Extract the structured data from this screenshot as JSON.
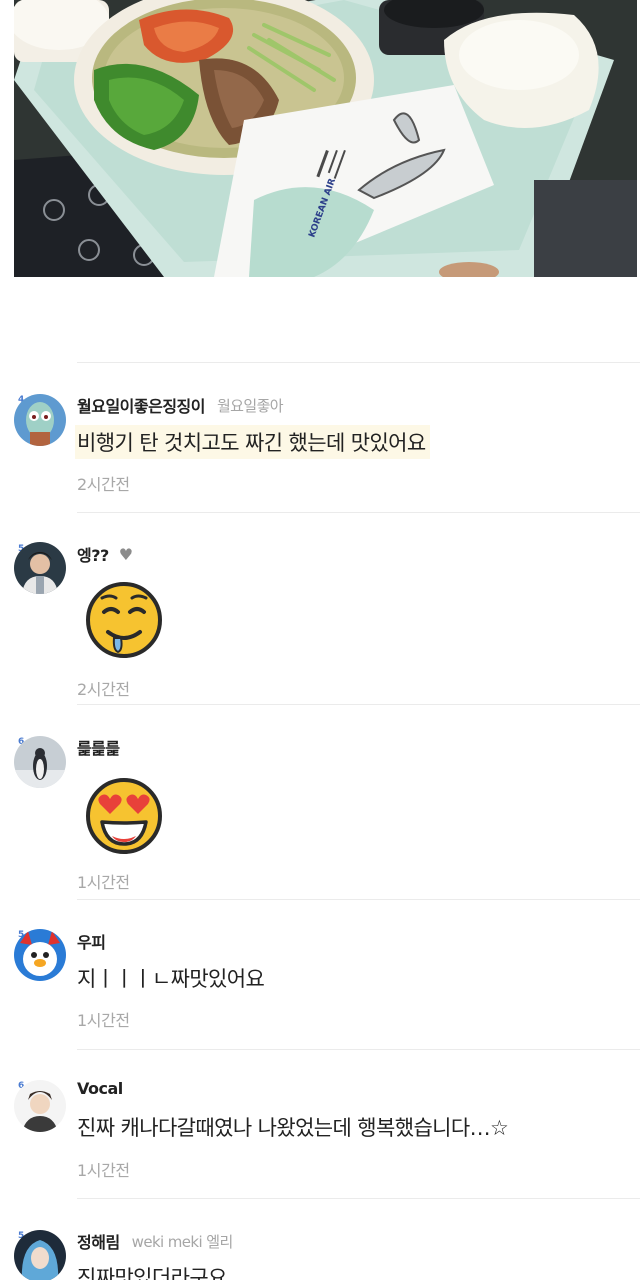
{
  "photo": {
    "tray_lid_brand": "KOREAN AIR"
  },
  "comments": [
    {
      "level": "4",
      "nickname": "월요일이좋은징징이",
      "subname": "월요일좋아",
      "text": "비행기 탄 것치고도 짜긴 했는데 맛있어요",
      "time": "2시간전",
      "avatar": "squidward-avatar",
      "highlight": true
    },
    {
      "level": "5",
      "nickname": "엥??",
      "heart": "♥",
      "emoji": "drooling-face-emoji",
      "time": "2시간전",
      "avatar": "person-avatar"
    },
    {
      "level": "6",
      "nickname": "릁릁릁",
      "emoji": "heart-eyes-emoji",
      "time": "1시간전",
      "avatar": "penguin-avatar"
    },
    {
      "level": "5",
      "nickname": "우피",
      "text": "지ㅣㅣㅣㄴ짜맛있어요",
      "time": "1시간전",
      "avatar": "blue-character-avatar"
    },
    {
      "level": "6",
      "nickname": "Vocal",
      "text": "진짜 캐나다갈때였나 나왔었는데 행복했습니다…☆",
      "time": "1시간전",
      "avatar": "sketch-person-avatar"
    },
    {
      "level": "5",
      "nickname": "정해림",
      "subname": "weki meki 엘리",
      "text": "진짜맛있더라구요",
      "avatar": "blue-hair-avatar"
    }
  ]
}
